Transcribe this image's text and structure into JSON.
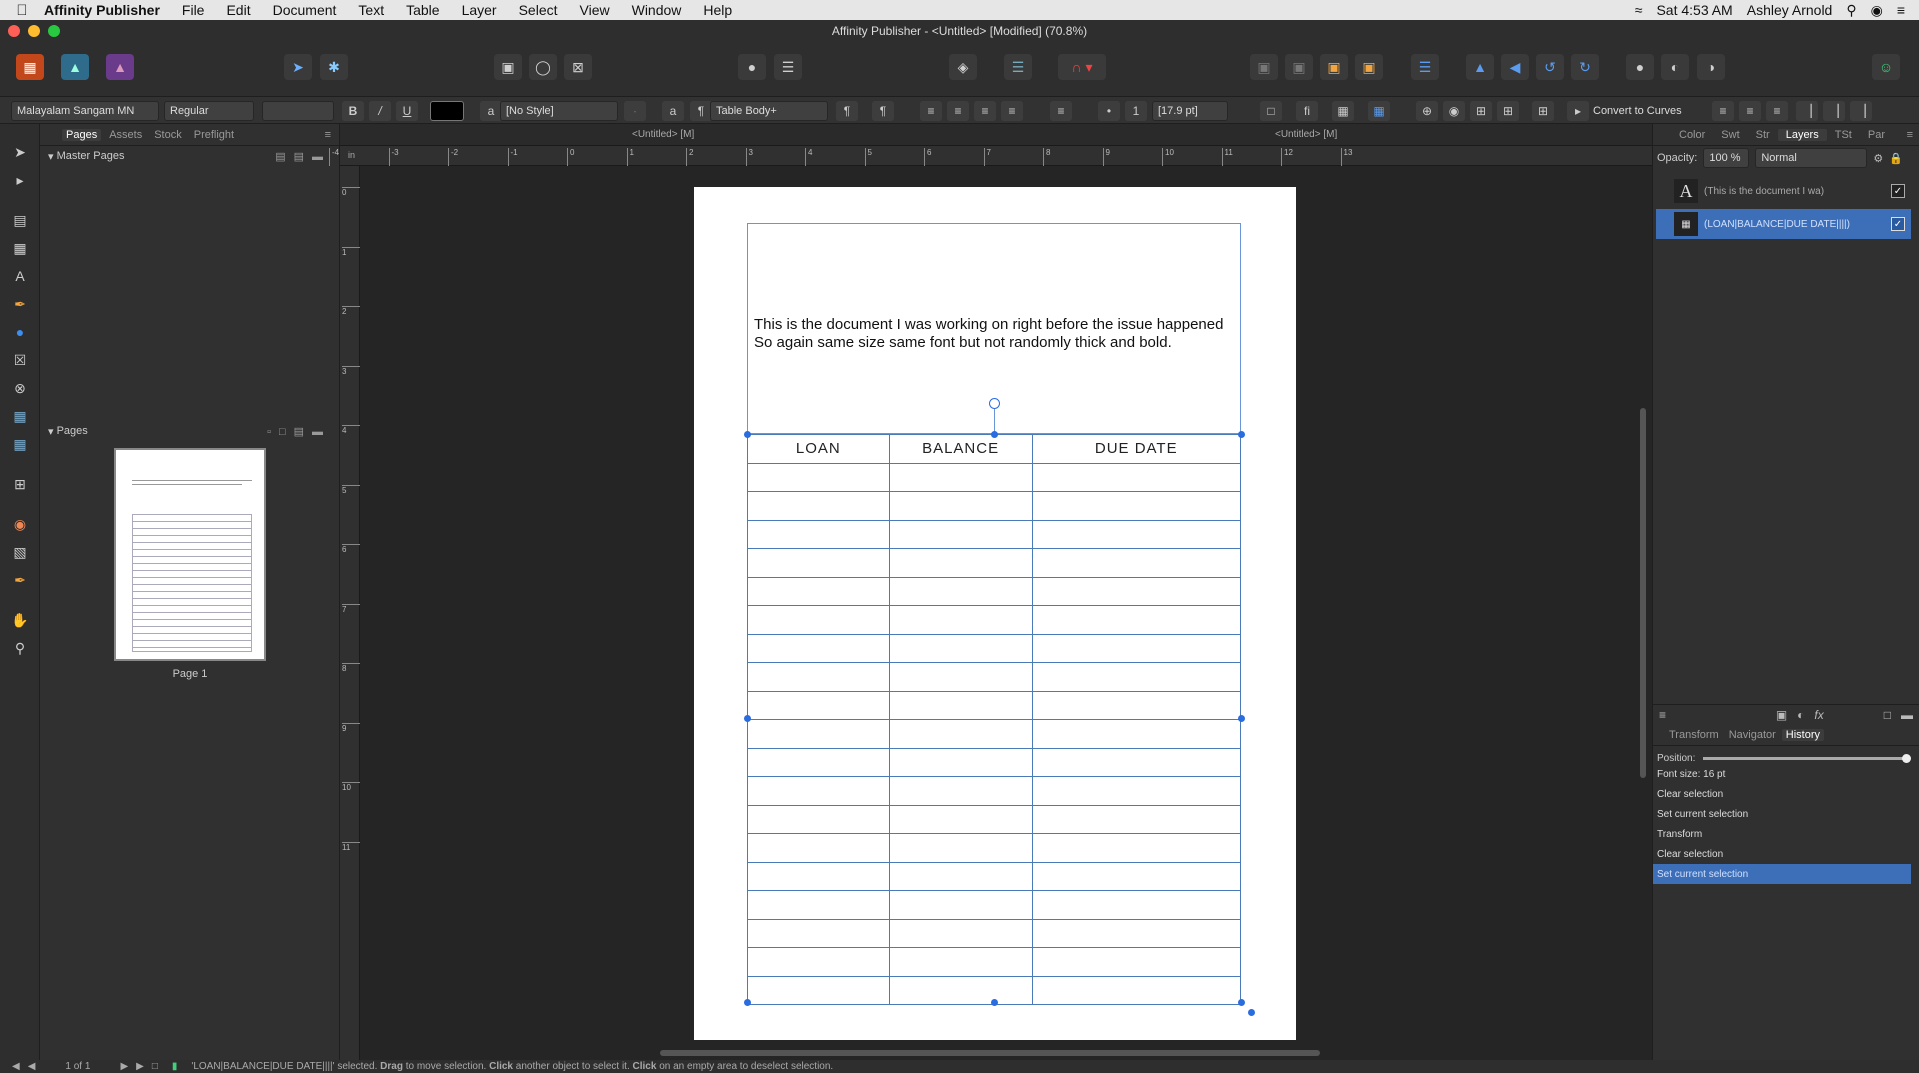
{
  "menubar": {
    "app_name": "Affinity Publisher",
    "items": [
      "File",
      "Edit",
      "Document",
      "Text",
      "Table",
      "Layer",
      "Select",
      "View",
      "Window",
      "Help"
    ],
    "clock": "Sat 4:53 AM",
    "user": "Ashley Arnold"
  },
  "window": {
    "title": "Affinity Publisher - <Untitled> [Modified] (70.8%)"
  },
  "context_toolbar": {
    "font_family": "Malayalam Sangam MN",
    "font_style": "Regular",
    "font_size": "",
    "char_style": "[No Style]",
    "para_style": "Table Body+",
    "leading": "[17.9 pt]",
    "convert_label": "Convert to Curves"
  },
  "left_panel": {
    "tabs": [
      "Pages",
      "Assets",
      "Stock",
      "Preflight"
    ],
    "master_pages_label": "Master Pages",
    "pages_label": "Pages",
    "page_caption": "Page 1"
  },
  "document": {
    "tab_label": "<Untitled> [M]",
    "tab_label_2": "<Untitled> [M]",
    "text_line_1": "This is the document I was working on right before the issue happened",
    "text_line_2": "So again same size same font but not randomly thick and bold.",
    "table_headers": [
      "LOAN",
      "BALANCE",
      "DUE DATE"
    ],
    "table_body_rows": 19
  },
  "ruler": {
    "unit": "in",
    "h_ticks": [
      "-4",
      "-3",
      "-2",
      "-1",
      "0",
      "1",
      "2",
      "3",
      "4",
      "5",
      "6",
      "7",
      "8",
      "9",
      "10",
      "11",
      "12",
      "13"
    ],
    "v_ticks": [
      "0",
      "1",
      "2",
      "3",
      "4",
      "5",
      "6",
      "7",
      "8",
      "9",
      "10",
      "11"
    ]
  },
  "right_panel": {
    "tabs": [
      "Color",
      "Swt",
      "Str",
      "Layers",
      "TSt",
      "Par"
    ],
    "opacity_label": "Opacity:",
    "opacity_value": "100 %",
    "blend_mode": "Normal",
    "layers": [
      {
        "name": "(This is the document I wa)",
        "selected": false
      },
      {
        "name": "(LOAN|BALANCE|DUE DATE||||)",
        "selected": true
      }
    ],
    "lower_tabs": [
      "Transform",
      "Navigator",
      "History"
    ],
    "position_label": "Position:",
    "history": [
      "Font size: 16 pt",
      "Clear selection",
      "Set current selection",
      "Transform",
      "Clear selection",
      "Set current selection"
    ]
  },
  "status": {
    "page_counter": "1 of 1",
    "message_pre": "'LOAN|BALANCE|DUE DATE||||' selected. ",
    "drag": "Drag",
    "msg2": " to move selection. ",
    "click": "Click",
    "msg3": " another object to select it. ",
    "click2": "Click",
    "msg4": " on an empty area to deselect selection."
  },
  "colors": {
    "accent": "#2a6de0",
    "table_line": "#4a7ab8",
    "selected_row": "#3d6fb8"
  }
}
